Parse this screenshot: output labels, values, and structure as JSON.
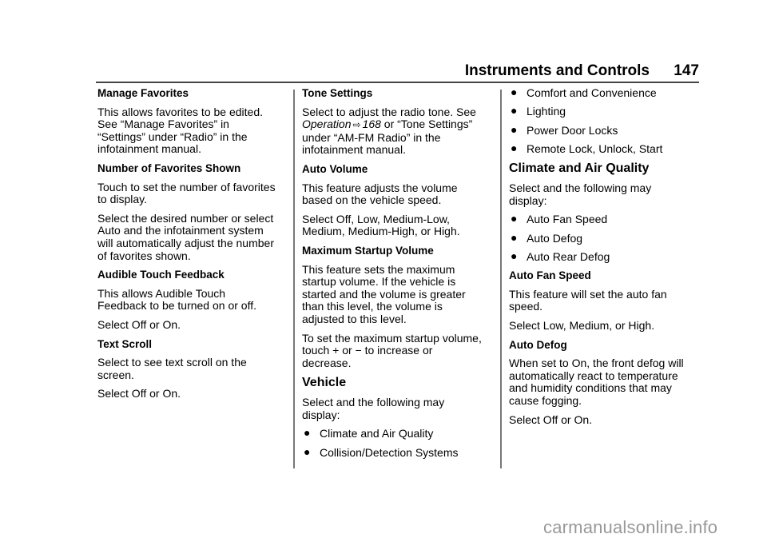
{
  "header": {
    "title": "Instruments and Controls",
    "page_number": "147"
  },
  "columns": {
    "col1": {
      "manage_favorites": {
        "heading": "Manage Favorites",
        "body": [
          "This allows favorites to be edited.",
          "See “Manage Favorites” in",
          "“Settings” under “Radio” in the",
          "infotainment manual."
        ]
      },
      "number_of_favorites": {
        "heading": "Number of Favorites Shown",
        "body1": [
          "Touch to set the number of favorites",
          "to display."
        ],
        "body2": [
          "Select the desired number or select",
          "Auto and the infotainment system",
          "will automatically adjust the number",
          "of favorites shown."
        ]
      },
      "audible_touch_feedback": {
        "heading": "Audible Touch Feedback",
        "body1": [
          "This allows Audible Touch",
          "Feedback to be turned on or off."
        ],
        "body2": "Select Off or On."
      },
      "text_scroll": {
        "heading": "Text Scroll",
        "body1": [
          "Select to see text scroll on the",
          "screen."
        ],
        "body2": "Select Off or On."
      }
    },
    "col2": {
      "tone_settings": {
        "heading": "Tone Settings",
        "line1": "Select to adjust the radio tone. See",
        "ref_text": "Operation",
        "ref_icon": "⇨",
        "ref_page": "168",
        "line2_rest": " or “Tone Settings”",
        "line3": "under “AM-FM Radio” in the",
        "line4": "infotainment manual."
      },
      "auto_volume": {
        "heading": "Auto Volume",
        "body1": [
          "This feature adjusts the volume",
          "based on the vehicle speed."
        ],
        "body2": [
          "Select Off, Low, Medium-Low,",
          "Medium, Medium-High, or High."
        ]
      },
      "max_startup_volume": {
        "heading": "Maximum Startup Volume",
        "body1": [
          "This feature sets the maximum",
          "startup volume. If the vehicle is",
          "started and the volume is greater",
          "than this level, the volume is",
          "adjusted to this level."
        ],
        "body2": [
          "To set the maximum startup volume,",
          "touch + or − to increase or",
          "decrease."
        ]
      },
      "vehicle": {
        "heading": "Vehicle",
        "intro": [
          "Select and the following may",
          "display:"
        ],
        "bullets": [
          "Climate and Air Quality",
          "Collision/Detection Systems"
        ]
      }
    },
    "col3": {
      "vehicle_bullets_cont": [
        "Comfort and Convenience",
        "Lighting",
        "Power Door Locks",
        "Remote Lock, Unlock, Start"
      ],
      "climate": {
        "heading": "Climate and Air Quality",
        "intro": [
          "Select and the following may",
          "display:"
        ],
        "bullets": [
          "Auto Fan Speed",
          "Auto Defog",
          "Auto Rear Defog"
        ]
      },
      "auto_fan_speed": {
        "heading": "Auto Fan Speed",
        "body1": [
          "This feature will set the auto fan",
          "speed."
        ],
        "body2": "Select Low, Medium, or High."
      },
      "auto_defog": {
        "heading": "Auto Defog",
        "body1": [
          "When set to On, the front defog will",
          "automatically react to temperature",
          "and humidity conditions that may",
          "cause fogging."
        ],
        "body2": "Select Off or On."
      }
    }
  },
  "bullet_glyph": "●",
  "watermark": "carmanualsonline.info"
}
